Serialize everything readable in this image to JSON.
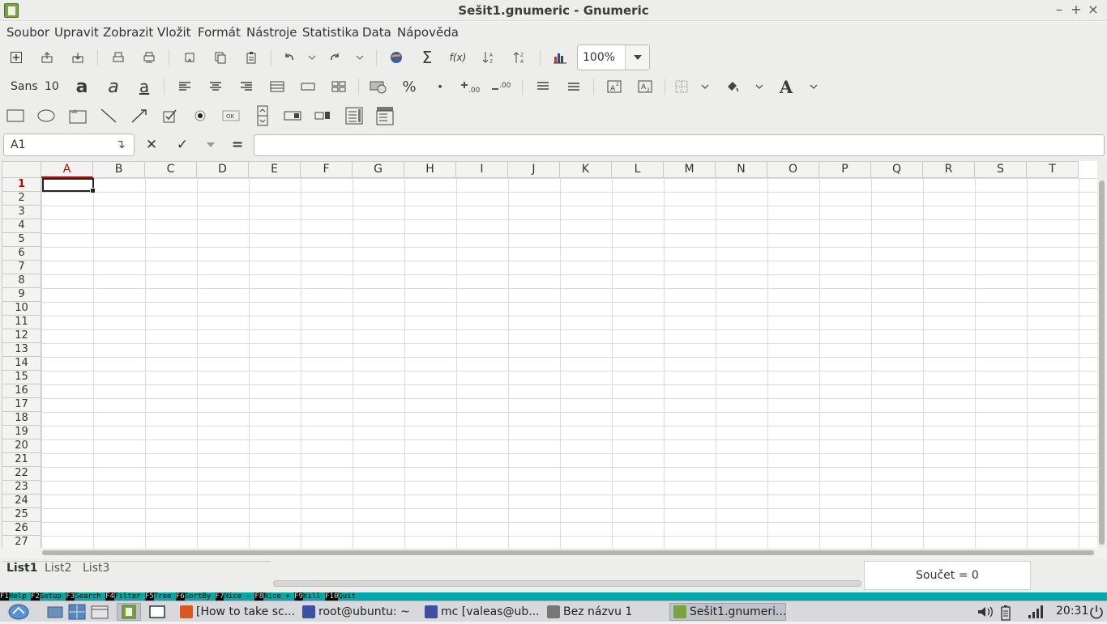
{
  "window": {
    "title": "Sešit1.gnumeric - Gnumeric",
    "minimize": "–",
    "maximize": "+",
    "close": "×"
  },
  "menubar": [
    "Soubor",
    "Upravit",
    "Zobrazit",
    "Vložit",
    "Formát",
    "Nástroje",
    "Statistika",
    "Data",
    "Nápověda"
  ],
  "toolbar": {
    "zoom": "100%",
    "font_name": "Sans",
    "font_size": "10"
  },
  "formula": {
    "name_box": "A1",
    "cancel": "✕",
    "accept": "✓",
    "equals": "=",
    "value": ""
  },
  "grid": {
    "columns": [
      "A",
      "B",
      "C",
      "D",
      "E",
      "F",
      "G",
      "H",
      "I",
      "J",
      "K",
      "L",
      "M",
      "N",
      "O",
      "P",
      "Q",
      "R",
      "S",
      "T"
    ],
    "rows": [
      "1",
      "2",
      "3",
      "4",
      "5",
      "6",
      "7",
      "8",
      "9",
      "10",
      "11",
      "12",
      "13",
      "14",
      "15",
      "16",
      "17",
      "18",
      "19",
      "20",
      "21",
      "22",
      "23",
      "24",
      "25",
      "26",
      "27"
    ],
    "active_column": "A",
    "active_row": "1"
  },
  "sheets": [
    "List1",
    "List2",
    "List3"
  ],
  "active_sheet": "List1",
  "status": {
    "sum": "Součet = 0"
  },
  "mc_keys": [
    {
      "n": "F1",
      "l": "Help"
    },
    {
      "n": "F2",
      "l": "Setup"
    },
    {
      "n": "F3",
      "l": "Search"
    },
    {
      "n": "F4",
      "l": "Filter"
    },
    {
      "n": "F5",
      "l": "Tree"
    },
    {
      "n": "F6",
      "l": "SortBy"
    },
    {
      "n": "F7",
      "l": "Nice -"
    },
    {
      "n": "F8",
      "l": "Nice +"
    },
    {
      "n": "F9",
      "l": "Kill"
    },
    {
      "n": "F10",
      "l": "Quit"
    }
  ],
  "taskbar": {
    "items": [
      {
        "label": "[How to take sc...",
        "color": "#d9581f"
      },
      {
        "label": "root@ubuntu: ~",
        "color": "#3c4fa3"
      },
      {
        "label": "mc [valeas@ub...",
        "color": "#3c4fa3"
      },
      {
        "label": "Bez názvu 1",
        "color": "#777777"
      },
      {
        "label": "Sešit1.gnumeri...",
        "color": "#7aa33e"
      }
    ],
    "clock": "20:31"
  }
}
